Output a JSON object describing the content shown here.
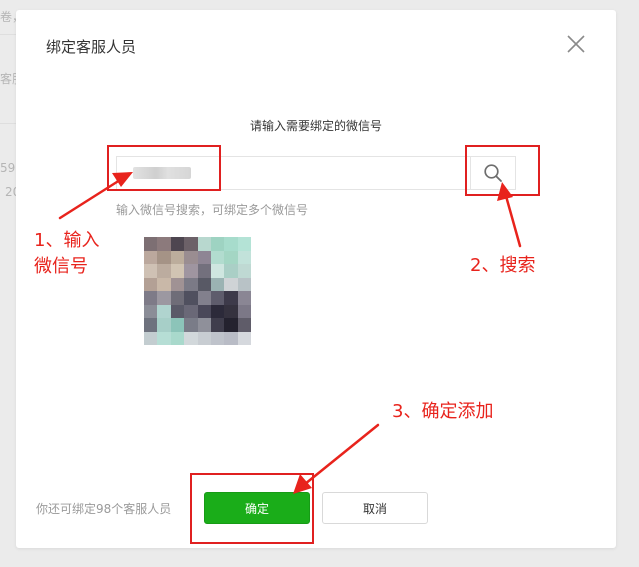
{
  "background_fragments": [
    "卷，",
    "客服",
    "59",
    "20"
  ],
  "dialog": {
    "title": "绑定客服人员",
    "prompt": "请输入需要绑定的微信号",
    "search": {
      "value": "",
      "placeholder": "",
      "button_icon": "search-icon"
    },
    "hint": "输入微信号搜索，可绑定多个微信号",
    "result_avatar": {
      "description_visible": "pixelated avatar",
      "colors": [
        "#7d6f73",
        "#8c7a7c",
        "#4e4650",
        "#6c6168",
        "#b8d8cf",
        "#9ed3c2",
        "#a7dccc",
        "#b4e3d6",
        "#bba89d",
        "#a59386",
        "#bcad9c",
        "#9a8d91",
        "#8e8594",
        "#b2dccf",
        "#a4d6c4",
        "#c2e2da",
        "#cfc1b4",
        "#bcac9f",
        "#d1c4b3",
        "#9f95a0",
        "#73707d",
        "#cfe6e0",
        "#aacfc6",
        "#bfd9d3",
        "#b3a095",
        "#c9b8a8",
        "#a09294",
        "#7b7a86",
        "#585965",
        "#9bb3b3",
        "#cfd3d6",
        "#b8c2c6",
        "#7e7b88",
        "#9c98a1",
        "#6f6d78",
        "#50505f",
        "#82808d",
        "#5e5c6c",
        "#3d3a4a",
        "#8a8694",
        "#8b8d97",
        "#b0d4cf",
        "#5a5a68",
        "#6a6877",
        "#4a4859",
        "#2c2a3a",
        "#35323f",
        "#7c7887",
        "#6e727e",
        "#a7cfc8",
        "#8cc4b9",
        "#7a7c88",
        "#8f909a",
        "#3f3d4c",
        "#24222f",
        "#5f5c69",
        "#c3cdd0",
        "#b6ded5",
        "#a9d9cc",
        "#d2d8db",
        "#c8cdd2",
        "#bfc3cb",
        "#b9bcc6",
        "#d5d8dd"
      ]
    },
    "quota_text": "你还可绑定98个客服人员",
    "confirm_label": "确定",
    "cancel_label": "取消",
    "close_icon": "close-icon"
  },
  "annotations": {
    "step1_line1": "1、输入",
    "step1_line2": "微信号",
    "step2": "2、搜索",
    "step3": "3、确定添加",
    "color": "#e8231c"
  }
}
